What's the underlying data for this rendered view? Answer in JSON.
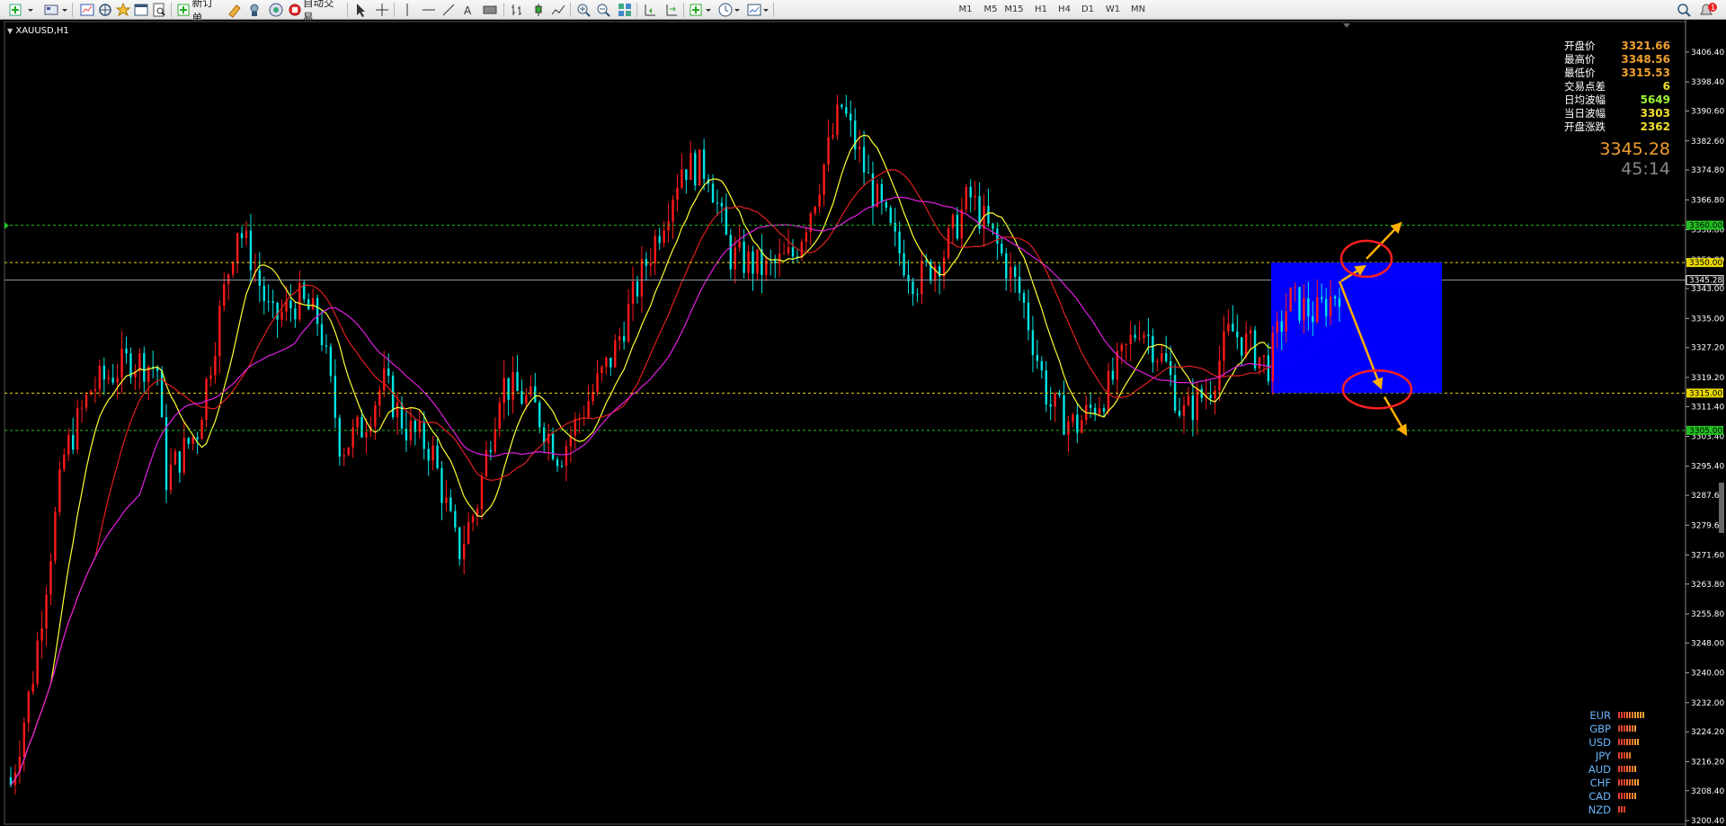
{
  "toolbar": {
    "new_order_label": "新订单",
    "auto_trade_label": "自动交易",
    "timeframes": [
      "M1",
      "M5",
      "M15",
      "H1",
      "H4",
      "D1",
      "W1",
      "MN"
    ]
  },
  "chart": {
    "symbol": "XAUUSD,H1"
  },
  "info_panel": {
    "rows": [
      {
        "label": "开盘价",
        "value": "3321.66"
      },
      {
        "label": "最高价",
        "value": "3348.56"
      },
      {
        "label": "最低价",
        "value": "3315.53"
      },
      {
        "label": "交易点差",
        "value": "6"
      },
      {
        "label": "日均波幅",
        "value": "5649"
      },
      {
        "label": "当日波幅",
        "value": "3303"
      },
      {
        "label": "开盘涨跌",
        "value": "2362"
      }
    ],
    "current_price": "3345.28",
    "countdown": "45:14"
  },
  "price_axis": {
    "ticks": [
      "3406.40",
      "3398.40",
      "3390.60",
      "3382.60",
      "3374.80",
      "3366.80",
      "3358.80",
      "3350.80",
      "3343.00",
      "3335.00",
      "3327.20",
      "3319.20",
      "3311.40",
      "3303.40",
      "3295.40",
      "3287.60",
      "3279.60",
      "3271.60",
      "3263.80",
      "3255.80",
      "3248.00",
      "3240.00",
      "3232.00",
      "3224.20",
      "3216.20",
      "3208.40",
      "3200.40"
    ],
    "level_labels": [
      {
        "text": "3360.00",
        "color": "#22c022"
      },
      {
        "text": "3350.00",
        "color": "#e8d800"
      },
      {
        "text": "3345.28",
        "color": "#ffffff"
      },
      {
        "text": "3315.00",
        "color": "#e8d800"
      },
      {
        "text": "3305.00",
        "color": "#22c022"
      }
    ]
  },
  "strength": [
    {
      "ccy": "EUR",
      "bars": 10
    },
    {
      "ccy": "GBP",
      "bars": 7
    },
    {
      "ccy": "USD",
      "bars": 8
    },
    {
      "ccy": "JPY",
      "bars": 5
    },
    {
      "ccy": "AUD",
      "bars": 7
    },
    {
      "ccy": "CHF",
      "bars": 8
    },
    {
      "ccy": "CAD",
      "bars": 7
    },
    {
      "ccy": "NZD",
      "bars": 3
    }
  ],
  "colors": {
    "bull": "#ff1a1a",
    "bear": "#00e5e5",
    "ma_fast": "#ffff33",
    "ma_mid": "#e01f1f",
    "ma_slow": "#e020e0",
    "box": "#0000ff",
    "arrow": "#ffb000",
    "ellipse": "#ff2020"
  }
}
